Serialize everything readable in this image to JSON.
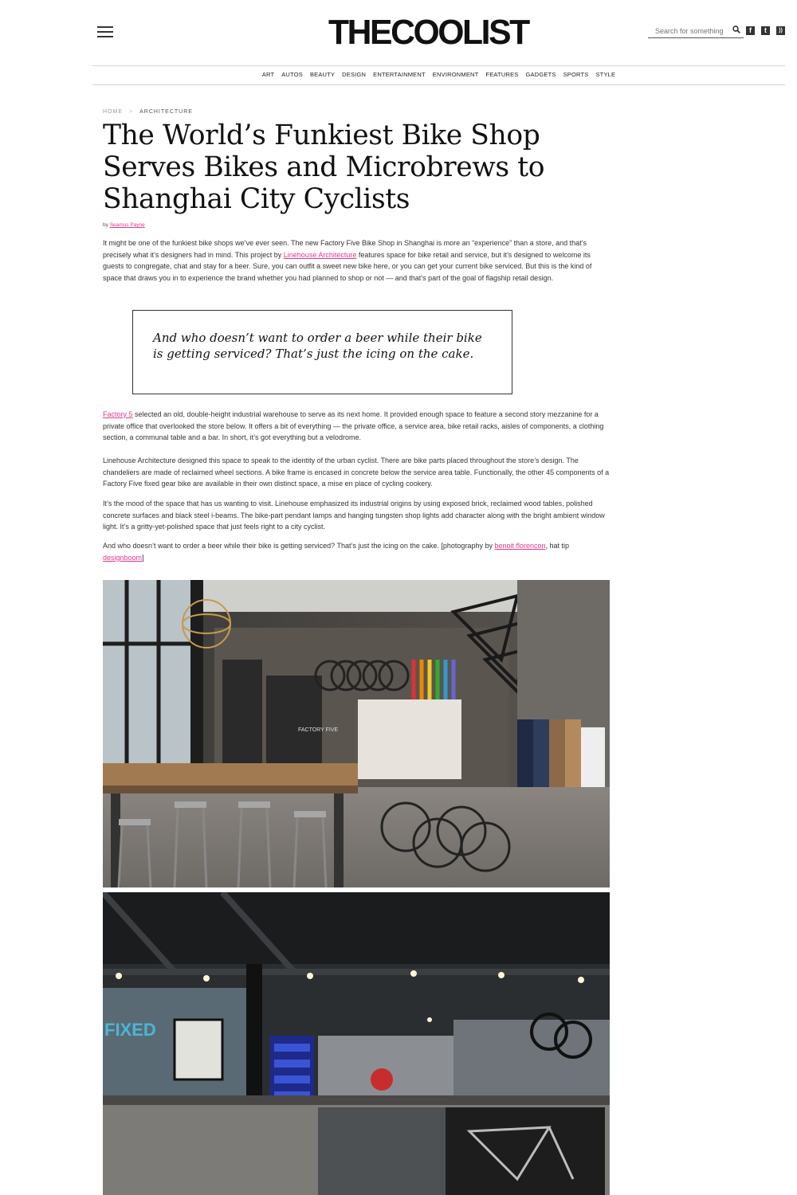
{
  "header": {
    "logo": "THECOOLIST",
    "search_placeholder": "Search for something cool",
    "social": [
      {
        "name": "facebook-icon",
        "glyph": "f"
      },
      {
        "name": "twitter-icon",
        "glyph": "t"
      },
      {
        "name": "rss-icon",
        "glyph": ")"
      }
    ]
  },
  "nav": {
    "items": [
      "ART",
      "AUTOS",
      "BEAUTY",
      "DESIGN",
      "ENTERTAINMENT",
      "ENVIRONMENT",
      "FEATURES",
      "GADGETS",
      "SPORTS",
      "STYLE"
    ]
  },
  "article": {
    "breadcrumb": {
      "home": "HOME",
      "sep": ">",
      "current": "ARCHITECTURE"
    },
    "title": "The World’s Funkiest Bike Shop Serves Bikes and Microbrews to Shanghai City Cyclists",
    "byline": {
      "prefix": "by",
      "author": "Seamus Payne"
    },
    "p1": {
      "before": "It might be one of the funkiest bike shops we’ve ever seen. The new Factory Five Bike Shop in Shanghai is more an “experience” than a store, and that’s precisely what it’s designers had in mind. This project by ",
      "link": "Linehouse Architecture",
      "after": " features space for bike retail and service, but it’s designed to welcome its guests to congregate, chat and stay for a beer. Sure, you can outfit a sweet new bike here, or you can get your current bike serviced. But this is the kind of space that draws you in to experience the brand whether you had planned to shop or not — and that’s part of the goal of flagship retail design."
    },
    "pullquote": "And who doesn’t want to order a beer while their bike is getting serviced? That’s just the icing on the cake.",
    "p2": {
      "link": "Factory 5",
      "after": " selected an old, double-height industrial warehouse to serve as its next home. It provided enough space to feature a second story mezzanine for a private office that overlooked the store below. It offers a bit of everything — the private office, a service area, bike retail racks, aisles of components, a clothing section, a communal table and a bar. In short, it’s got everything but a velodrome."
    },
    "p3": "Linehouse Architecture designed this space to speak to the identity of the urban cyclist. There are bike parts placed throughout the store’s design. The chandeliers are made of reclaimed wheel sections. A bike frame is encased in concrete below the service area table. Functionally, the other 45 components of a Factory Five fixed gear bike are available in their own distinct space, a mise en place of cycling cookery.",
    "p4": "It’s the mood of the space that has us wanting to visit. Linehouse emphasized its industrial origins by using exposed brick, reclaimed wood tables, polished concrete surfaces and black steel i-beams. The bike-part pendant lamps and hanging tungsten shop lights add character along with the bright ambient window light. It’s a gritty-yet-polished space that just feels right to a city cyclist.",
    "p5": {
      "before": "And who doesn’t want to order a beer while their bike is getting serviced? That’s just the icing on the cake. [photography by ",
      "link1": "benoit florencon",
      "middle": ", hat tip ",
      "link2": "designboom",
      "after": "]"
    },
    "photo1_label": "FACTORY FIVE",
    "photo2_label": "FIXED"
  },
  "colors": {
    "link": "#e0388a",
    "text": "#333333",
    "rule": "#d4d4d4"
  }
}
